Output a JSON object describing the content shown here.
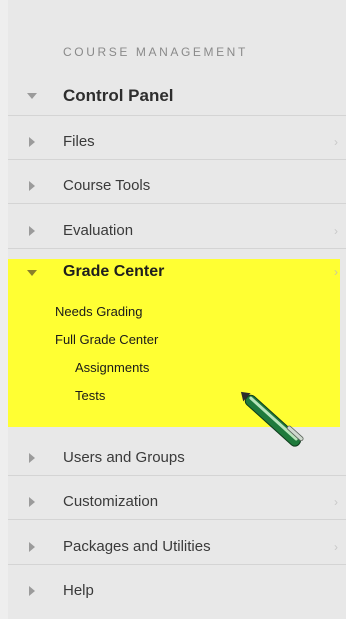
{
  "section": {
    "label": "COURSE MANAGEMENT"
  },
  "control_panel": {
    "label": "Control Panel"
  },
  "items": [
    {
      "label": "Files",
      "has_chevron": true
    },
    {
      "label": "Course Tools",
      "has_chevron": false
    },
    {
      "label": "Evaluation",
      "has_chevron": true
    }
  ],
  "grade_center": {
    "label": "Grade Center",
    "children": [
      {
        "label": "Needs Grading"
      },
      {
        "label": "Full Grade Center"
      },
      {
        "label": "Assignments"
      },
      {
        "label": "Tests"
      }
    ]
  },
  "items_after": [
    {
      "label": "Users and Groups",
      "has_chevron": false
    },
    {
      "label": "Customization",
      "has_chevron": true
    },
    {
      "label": "Packages and Utilities",
      "has_chevron": true
    },
    {
      "label": "Help",
      "has_chevron": false
    }
  ],
  "icons": {
    "collapse": "triangle-right-icon",
    "expand": "triangle-down-icon",
    "chevron": "chevron-right-icon",
    "pen": "pen-icon"
  },
  "colors": {
    "highlight": "#ffff33",
    "panel_bg": "#e8e8e8"
  },
  "chevron_glyph": "›"
}
